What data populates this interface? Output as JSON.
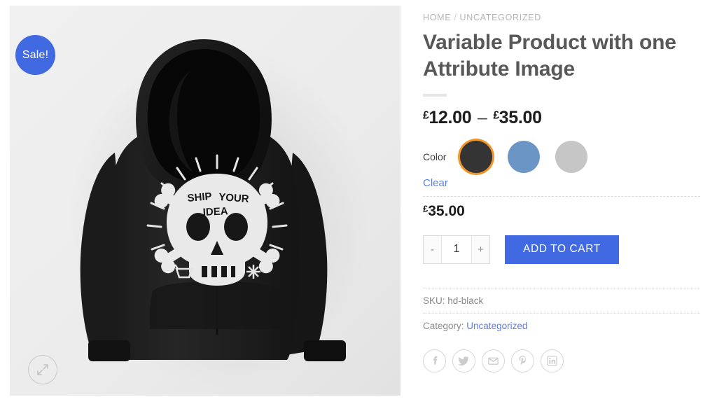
{
  "breadcrumb": {
    "home": "HOME",
    "separator": "/",
    "current": "UNCATEGORIZED"
  },
  "product": {
    "title": "Variable Product with one Attribute Image",
    "price_range": {
      "currency": "£",
      "min": "12.00",
      "dash": "–",
      "max": "35.00"
    },
    "selected_price": {
      "currency": "£",
      "amount": "35.00"
    },
    "sale_badge": "Sale!",
    "image_alt": "Black hoodie with skull and crossbones Ship Your Idea graphic"
  },
  "variations": {
    "attribute_label": "Color",
    "clear_label": "Clear",
    "swatches": [
      {
        "name": "black",
        "color": "#343434",
        "selected": true
      },
      {
        "name": "blue",
        "color": "#6b95c4",
        "selected": false
      },
      {
        "name": "grey",
        "color": "#c6c6c6",
        "selected": false
      }
    ],
    "selected_ring_color": "#f0962b"
  },
  "cart": {
    "decrease_label": "-",
    "quantity_value": "1",
    "quantity_placeholder": "1",
    "increase_label": "+",
    "add_to_cart_label": "Add to cart",
    "button_color": "#4169e1"
  },
  "meta": {
    "sku_label": "SKU:",
    "sku_value": "hd-black",
    "category_label": "Category:",
    "category_value": "Uncategorized"
  },
  "share": {
    "items": [
      {
        "name": "facebook",
        "label": "Facebook"
      },
      {
        "name": "twitter",
        "label": "Twitter"
      },
      {
        "name": "email",
        "label": "Email"
      },
      {
        "name": "pinterest",
        "label": "Pinterest"
      },
      {
        "name": "linkedin",
        "label": "LinkedIn"
      }
    ]
  },
  "gallery": {
    "zoom_label": "Zoom",
    "background": "#ececec"
  }
}
